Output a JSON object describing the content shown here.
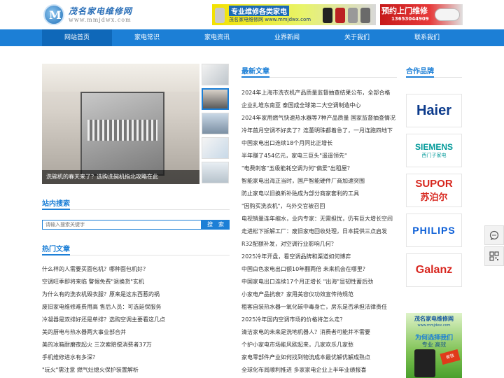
{
  "header": {
    "logo_title": "茂名家电维修网",
    "logo_url": "www.mmjdwx.com",
    "logo_letter": "M",
    "banner_left_title": "专业维修各类家电",
    "banner_left_sub": "茂名家电维修网 www.mmjdwx.com",
    "banner_right_title": "预约上门维修",
    "banner_right_phone": "13653044909"
  },
  "nav": {
    "items": [
      {
        "label": "网站首页"
      },
      {
        "label": "家电常识"
      },
      {
        "label": "家电资讯"
      },
      {
        "label": "业界新闻"
      },
      {
        "label": "关于我们"
      },
      {
        "label": "联系我们"
      }
    ]
  },
  "slider": {
    "caption": "洗碗机的春天来了？选购洗碗机指北攻略在此"
  },
  "search": {
    "title": "站内搜索",
    "placeholder": "请输入搜索关键字",
    "button": "搜　索"
  },
  "hot": {
    "title": "热门文章",
    "items": [
      "什么样的人需要买面包机？哪种面包机好？",
      "空调旺季即将来临 警惕免费\"退换货\"玄机",
      "为什么有的洗衣机毁衣服？原来是这东西惹的祸",
      "废旧家电维修难费用高 售后人员：可选延保服务",
      "冷凝器是双排好还是单排？选购空调主要看这几点",
      "美的厨电与热水器两大事业部合并",
      "美的冰箱耐磨夜起火 三次索赔偿消费者37万",
      "手机维修进水有多深？",
      "\"玩火\"需注意 燃气灶熄火保护装置解析"
    ]
  },
  "latest": {
    "title": "最新文章",
    "items": [
      "2024年上海市洗衣机产品质量监督抽查结果公布，全部合格",
      "企业扎堆东南亚 泰国成全球第二大空调制造中心",
      "2024年家用燃气快速热水器等7种产品质量 国家监督抽查情况",
      "冷年首月空调不好卖了？连董明珠都着急了，一月连跑四地下",
      "中国家电出口连续18个月同比正增长",
      "半年赚了454亿元，家电三巨头\"遥遥领先\"",
      "\"电费刺客\"五级能耗空调为何\"偏爱\"出租屋？",
      "智能家电出海正当时，国产智能硬件厂商加速突围",
      "防止家电以旧换新补贴成为部分商家套利的工具",
      "\"因购买洗衣机\"，乌外交官被召回",
      "电视销量连年缩水，业内专家：无需担忧，仍有巨大增长空间",
      "走进松下拆解工厂：废旧家电回收处理，日本提供三点启发",
      "R32配额补发，对空调行业影响几何？",
      "2025冷年开盘，看空调品牌和渠道如何博弈",
      "中国白色家电出口额10年翻两倍 未来机会在哪里？",
      "中国家电出口连续17个月正增长 \"出海\"显韧性蓄后劲",
      "小家电产品抗衰？家用美容仪功效宣传待规范",
      "租客自装热水器一氧化碳中毒身亡，房东是否承担法律责任",
      "2025冷年国内空调市场的价格将怎么走？",
      "清洁家电的未来是洗地机器人？消费者可能并不需要",
      "个护小家电市场能风欧起来，几家欢乐几家愁",
      "家电零部件产业如何找到物流成本最优解优解成熟点",
      "全球化布局顺利推进 多家家电企业上半年业绩报喜"
    ]
  },
  "brands": {
    "title": "合作品牌",
    "items": [
      {
        "name": "Haier",
        "sub": ""
      },
      {
        "name": "SIEMENS",
        "sub": "西门子家电"
      },
      {
        "name": "SUPOR",
        "sub": "苏泊尔"
      },
      {
        "name": "PHILIPS",
        "sub": ""
      },
      {
        "name": "Galanz",
        "sub": ""
      }
    ]
  },
  "ad": {
    "title": "茂名家电维修网",
    "url": "www.mmjdwx.com",
    "slogan": "为何选择我们",
    "slogan2": "专业 高效",
    "badge": "省钱"
  },
  "colors": {
    "nav_bg": "#1c7fd6",
    "accent": "#1c7fd6",
    "haier": "#0c3b8c",
    "siemens": "#009999",
    "supor": "#d7261d",
    "philips": "#0b5ed7",
    "galanz": "#d8261f"
  },
  "icons": [
    "chat-icon",
    "qrcode-icon"
  ]
}
